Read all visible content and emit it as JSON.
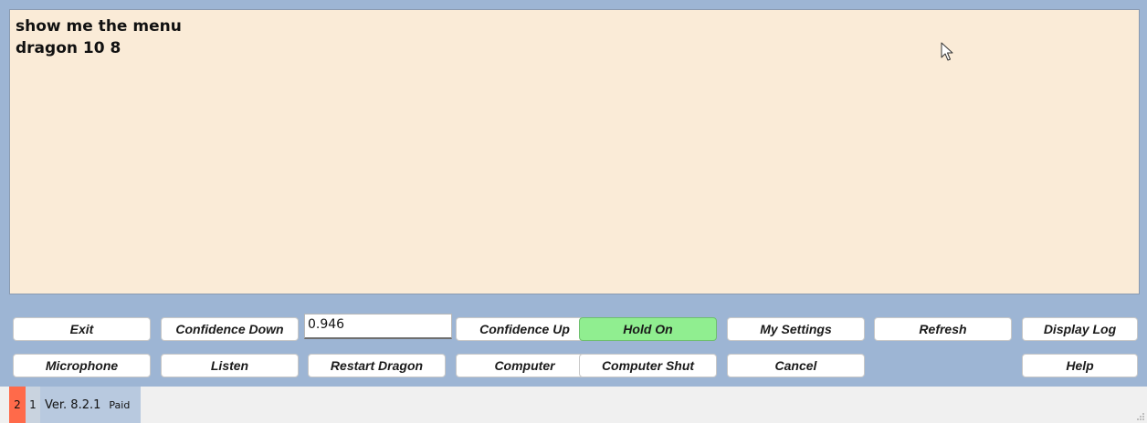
{
  "log": {
    "lines": [
      "show me the menu",
      "dragon 10 8"
    ]
  },
  "toolbar": {
    "row1": {
      "exit": "Exit",
      "confidence_down": "Confidence Down",
      "confidence_value": "0.946",
      "confidence_up": "Confidence Up",
      "hold_on": "Hold On",
      "my_settings": "My Settings",
      "refresh": "Refresh",
      "display_log": "Display Log"
    },
    "row2": {
      "microphone": "Microphone",
      "listen": "Listen",
      "restart_dragon": "Restart Dragon",
      "computer": "Computer",
      "computer_shut": "Computer Shut",
      "cancel": "Cancel",
      "help": "Help"
    }
  },
  "status": {
    "segment_1": "2",
    "segment_2": "1",
    "version": "Ver. 8.2.1",
    "license": "Paid"
  },
  "colors": {
    "background": "#9db5d4",
    "log_background": "#faebd7",
    "hold_on_active": "#90ee90",
    "status_red": "#ff6a4a"
  },
  "icons": [
    "mouse-pointer-icon",
    "resize-grip-icon"
  ]
}
